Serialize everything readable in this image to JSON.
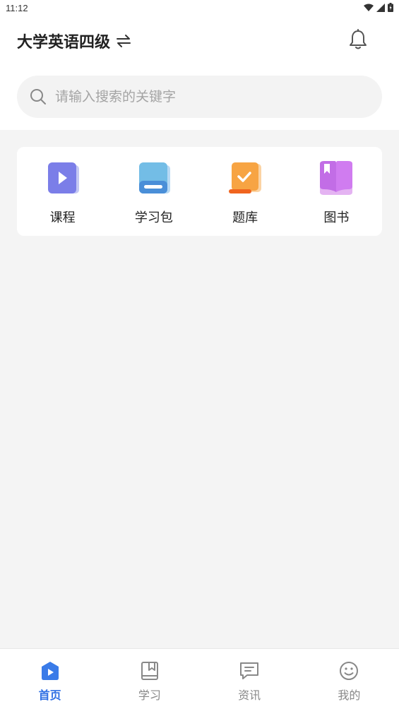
{
  "status_bar": {
    "time": "11:12"
  },
  "header": {
    "title": "大学英语四级"
  },
  "search": {
    "placeholder": "请输入搜索的关键字"
  },
  "quick_menu": [
    {
      "label": "课程",
      "icon": "video-play-icon"
    },
    {
      "label": "学习包",
      "icon": "book-icon"
    },
    {
      "label": "题库",
      "icon": "checklist-icon"
    },
    {
      "label": "图书",
      "icon": "open-book-icon"
    }
  ],
  "tabbar": {
    "active_color": "#2f6fe4",
    "items": [
      {
        "label": "首页",
        "icon": "home-icon",
        "active": true
      },
      {
        "label": "学习",
        "icon": "bookmark-icon",
        "active": false
      },
      {
        "label": "资讯",
        "icon": "message-icon",
        "active": false
      },
      {
        "label": "我的",
        "icon": "smiley-icon",
        "active": false
      }
    ]
  }
}
